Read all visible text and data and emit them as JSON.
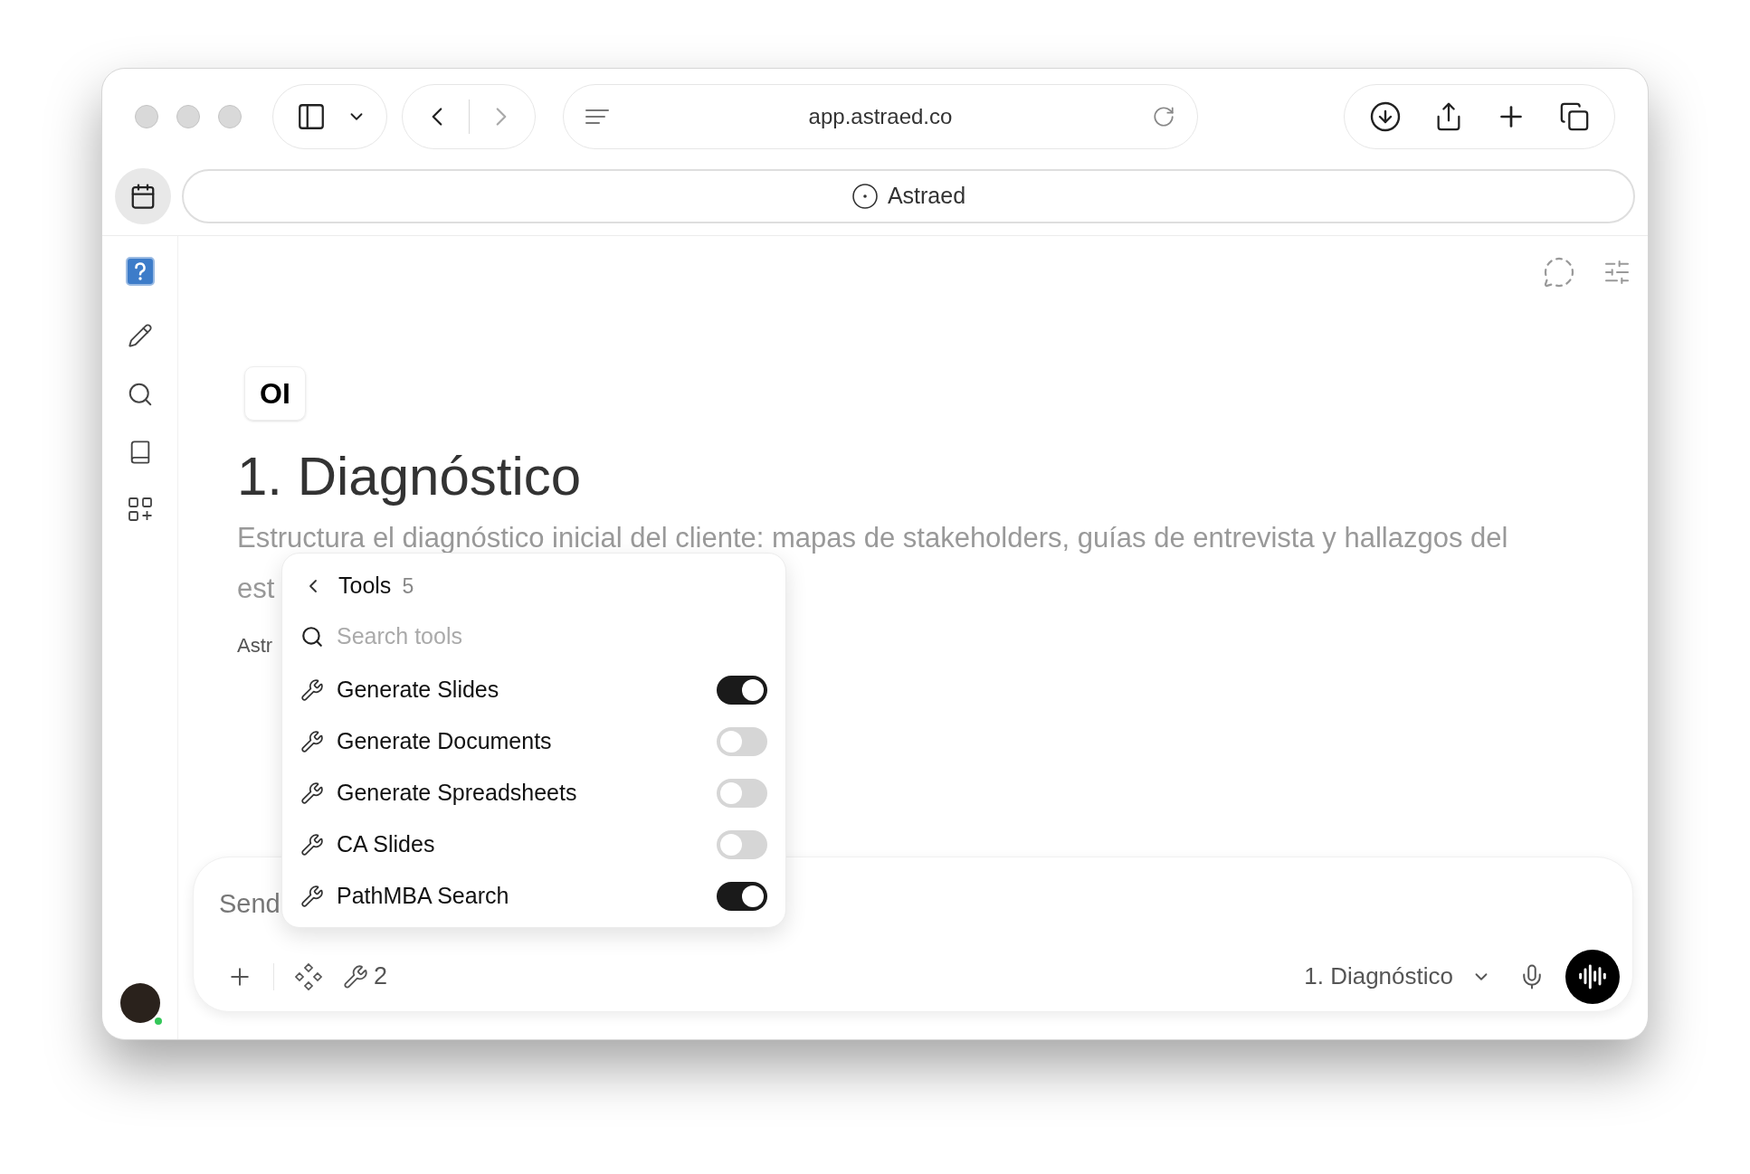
{
  "browser": {
    "url": "app.astraed.co",
    "tab_title": "Astraed"
  },
  "page": {
    "logo": "OI",
    "title": "1. Diagnóstico",
    "description_lines": [
      "Estructura el diagnóstico inicial del cliente: mapas de stakeholders, guías de entrevista y hallazgos del",
      "est"
    ],
    "byline": "Astr"
  },
  "tools_popup": {
    "title": "Tools",
    "count": "5",
    "search_placeholder": "Search tools",
    "items": [
      {
        "label": "Generate Slides",
        "on": true
      },
      {
        "label": "Generate Documents",
        "on": false
      },
      {
        "label": "Generate Spreadsheets",
        "on": false
      },
      {
        "label": "CA Slides",
        "on": false
      },
      {
        "label": "PathMBA Search",
        "on": true
      }
    ]
  },
  "composer": {
    "placeholder": "Send",
    "tools_count": "2",
    "project": "1. Diagnóstico"
  }
}
